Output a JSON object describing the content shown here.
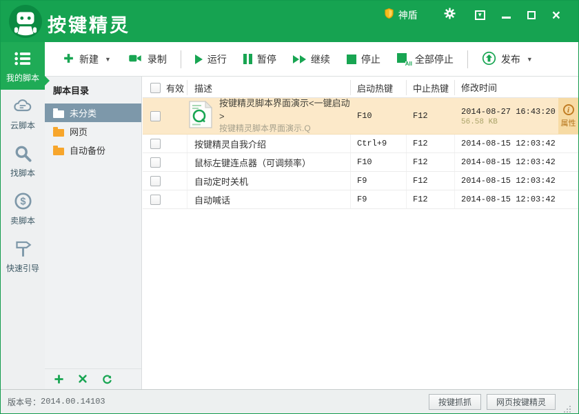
{
  "header": {
    "app_title": "按键精灵",
    "shield_label": "神盾"
  },
  "sidebar": {
    "items": [
      {
        "label": "我的脚本",
        "active": true
      },
      {
        "label": "云脚本",
        "active": false
      },
      {
        "label": "找脚本",
        "active": false
      },
      {
        "label": "卖脚本",
        "active": false
      },
      {
        "label": "快速引导",
        "active": false
      }
    ]
  },
  "toolbar": {
    "new_label": "新建",
    "record_label": "录制",
    "run_label": "运行",
    "pause_label": "暂停",
    "continue_label": "继续",
    "stop_label": "停止",
    "stop_all_label": "全部停止",
    "stop_all_badge": "All",
    "publish_label": "发布"
  },
  "folder_panel": {
    "title": "脚本目录",
    "folders": [
      {
        "label": "未分类",
        "selected": true
      },
      {
        "label": "网页",
        "selected": false
      },
      {
        "label": "自动备份",
        "selected": false
      }
    ]
  },
  "table": {
    "headers": {
      "valid": "有效",
      "description": "描述",
      "start_hotkey": "启动热键",
      "abort_hotkey": "中止热键",
      "modified": "修改时间"
    },
    "selected_row": {
      "title": "按键精灵脚本界面演示<一键启动>",
      "subtitle": "按键精灵脚本界面演示.Q",
      "start_hotkey": "F10",
      "abort_hotkey": "F12",
      "modified": "2014-08-27 16:43:20",
      "size": "56.58 KB",
      "props_label": "属性"
    },
    "rows": [
      {
        "title": "按键精灵自我介绍",
        "start_hotkey": "Ctrl+9",
        "abort_hotkey": "F12",
        "modified": "2014-08-15 12:03:42"
      },
      {
        "title": "鼠标左键连点器（可调频率）",
        "start_hotkey": "F10",
        "abort_hotkey": "F12",
        "modified": "2014-08-15 12:03:42"
      },
      {
        "title": "自动定时关机",
        "start_hotkey": "F9",
        "abort_hotkey": "F12",
        "modified": "2014-08-15 12:03:42"
      },
      {
        "title": "自动喊话",
        "start_hotkey": "F9",
        "abort_hotkey": "F12",
        "modified": "2014-08-15 12:03:42"
      }
    ]
  },
  "statusbar": {
    "version_label": "版本号：",
    "version_value": "2014.00.14103",
    "buttons": [
      {
        "label": "按键抓抓"
      },
      {
        "label": "网页按键精灵"
      }
    ]
  },
  "colors": {
    "brand_green": "#16a351",
    "active_green": "#1fab56",
    "highlight_row": "#fce9c9",
    "selected_folder": "#7d98aa",
    "folder_orange": "#f7a62c"
  }
}
